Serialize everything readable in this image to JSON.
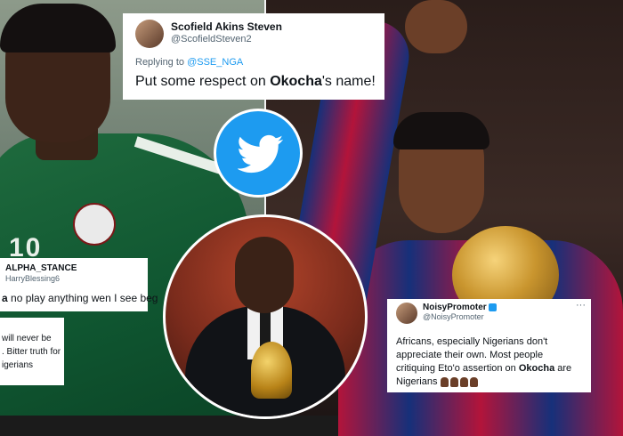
{
  "tweet_top": {
    "name": "Scofield Akins Steven",
    "handle": "@ScofieldSteven2",
    "replying_prefix": "Replying to ",
    "replying_to": "@SSE_NGA",
    "text_before": "Put some respect on ",
    "text_bold": "Okocha",
    "text_after": "'s name!"
  },
  "tweet_mid": {
    "name": "ALPHA_STANCE",
    "handle": "HarryBlessing6",
    "text_bold": "a",
    "text_after": " no play anything wen I see beg"
  },
  "tweet_low": {
    "lines": [
      "will never be",
      ". Bitter truth for",
      "igerians"
    ]
  },
  "tweet_right": {
    "name": "NoisyPromoter",
    "handle": "@NoisyPromoter",
    "more": "···",
    "line1": "Africans, especially Nigerians don't",
    "line2": "appreciate their own. Most people",
    "line3_before": "critiquing Eto'o assertion on ",
    "line3_bold": "Okocha",
    "line3_after": " are",
    "line4": "Nigerians"
  },
  "left_jersey_number": "10",
  "colors": {
    "twitter_blue": "#1d9bf0",
    "nigeria_green": "#0f5530",
    "barca_red": "#b3143a",
    "barca_blue": "#16307a"
  },
  "icons": {
    "logo": "twitter-bird-icon",
    "verified": "verified-badge-icon",
    "emoji": "woman-bowing-emoji-icon"
  }
}
